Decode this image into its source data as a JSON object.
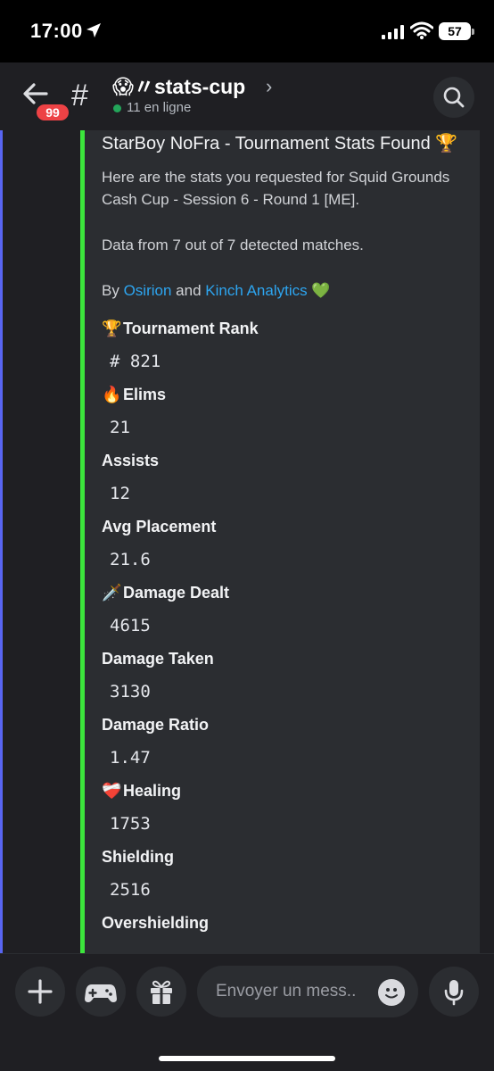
{
  "status_bar": {
    "time": "17:00",
    "battery": "57"
  },
  "header": {
    "badge_count": "99",
    "channel_name": "😱〃stats-cup",
    "online_text": "11 en ligne"
  },
  "embed": {
    "title": "StarBoy NoFra - Tournament Stats Found 🏆",
    "description": "Here are the stats you requested for Squid Grounds Cash Cup - Session 6 - Round 1 [ME].",
    "data_line": "Data from 7 out of 7 detected matches.",
    "credit_prefix": "By",
    "credit_link1": "Osirion",
    "credit_and": "and",
    "credit_link2": "Kinch Analytics",
    "credit_emoji": "💚",
    "fields": [
      {
        "emoji": "🏆",
        "name": "Tournament Rank",
        "value": "# 821"
      },
      {
        "emoji": "🔥",
        "name": "Elims",
        "value": "21"
      },
      {
        "emoji": "",
        "name": "Assists",
        "value": "12"
      },
      {
        "emoji": "",
        "name": "Avg Placement",
        "value": "21.6"
      },
      {
        "emoji": "🗡️",
        "name": "Damage Dealt",
        "value": "4615"
      },
      {
        "emoji": "",
        "name": "Damage Taken",
        "value": "3130"
      },
      {
        "emoji": "",
        "name": "Damage Ratio",
        "value": "1.47"
      },
      {
        "emoji": "❤️‍🩹",
        "name": "Healing",
        "value": "1753"
      },
      {
        "emoji": "",
        "name": "Shielding",
        "value": "2516"
      },
      {
        "emoji": "",
        "name": "Overshielding",
        "value": ""
      }
    ]
  },
  "composer": {
    "placeholder": "Envoyer un mess.."
  },
  "icons": {
    "back": "arrow-left-icon",
    "channel": "hash-icon",
    "search": "search-icon",
    "plus": "plus-icon",
    "games": "gamepad-icon",
    "gift": "gift-icon",
    "emoji": "smiley-icon",
    "mic": "microphone-icon"
  },
  "colors": {
    "embed_accent": "#3ce63c",
    "link": "#2da5f0",
    "badge": "#ed4245",
    "online": "#23a55a",
    "background": "#1f1f23",
    "embed_bg": "#2b2d31"
  }
}
